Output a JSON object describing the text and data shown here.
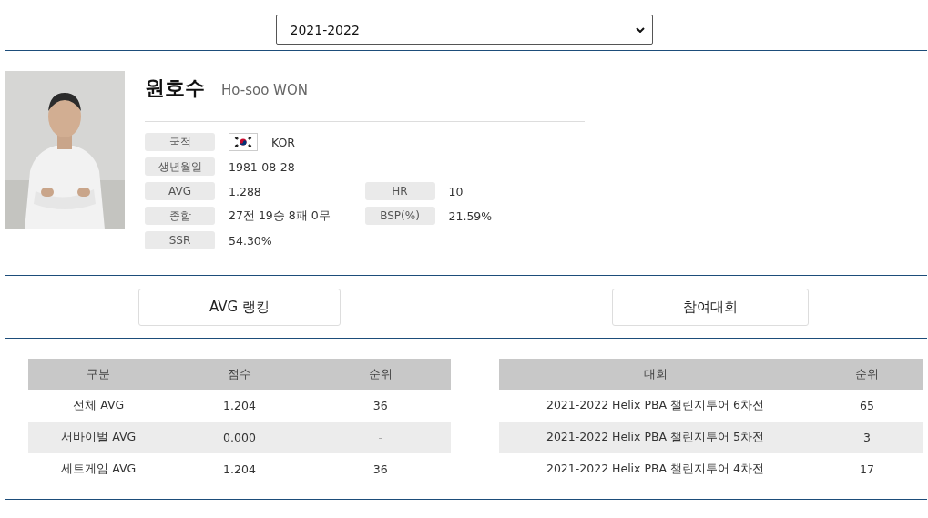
{
  "season_select": {
    "value": "2021-2022"
  },
  "player": {
    "name": "원호수",
    "name_en": "Ho-soo WON",
    "info": [
      {
        "label": "국적",
        "value": "KOR",
        "kind": "flag"
      },
      {
        "label": "생년월일",
        "value": "1981-08-28",
        "kind": "text"
      },
      {
        "label": "AVG",
        "value": "1.288",
        "kind": "text",
        "extra": {
          "label": "HR",
          "value": "10"
        }
      },
      {
        "label": "종합",
        "value": "27전 19승 8패 0무",
        "kind": "text",
        "extra": {
          "label": "BSP(%)",
          "value": "21.59%"
        }
      },
      {
        "label": "SSR",
        "value": "54.30%",
        "kind": "text"
      }
    ]
  },
  "buttons": [
    "AVG 랭킹",
    "참여대회"
  ],
  "avg_table": {
    "columns": [
      "구분",
      "점수",
      "순위"
    ],
    "rows": [
      [
        "전체 AVG",
        "1.204",
        "36"
      ],
      [
        "서바이벌 AVG",
        "0.000",
        "-"
      ],
      [
        "세트게임 AVG",
        "1.204",
        "36"
      ]
    ]
  },
  "tournament_table": {
    "columns": [
      "대회",
      "순위"
    ],
    "rows": [
      [
        "2021-2022 Helix PBA 챌린지투어 6차전",
        "65"
      ],
      [
        "2021-2022 Helix PBA 챌린지투어 5차전",
        "3"
      ],
      [
        "2021-2022 Helix PBA 챌린지투어 4차전",
        "17"
      ]
    ]
  }
}
